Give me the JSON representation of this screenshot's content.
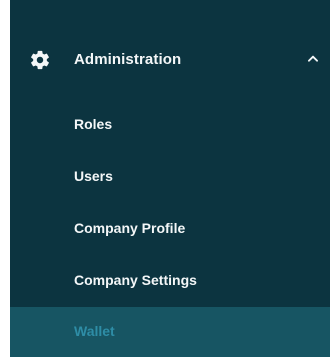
{
  "sidebar": {
    "section": {
      "title": "Administration",
      "icon": "gear-icon",
      "toggle_icon": "chevron-up-icon",
      "expanded": true
    },
    "items": [
      {
        "label": "Roles",
        "active": false
      },
      {
        "label": "Users",
        "active": false
      },
      {
        "label": "Company Profile",
        "active": false
      },
      {
        "label": "Company Settings",
        "active": false
      },
      {
        "label": "Wallet",
        "active": true
      }
    ]
  },
  "colors": {
    "panel_bg": "#0c3440",
    "active_bg": "#175563",
    "active_text": "#2e8da6",
    "text": "#f4f7f8"
  }
}
